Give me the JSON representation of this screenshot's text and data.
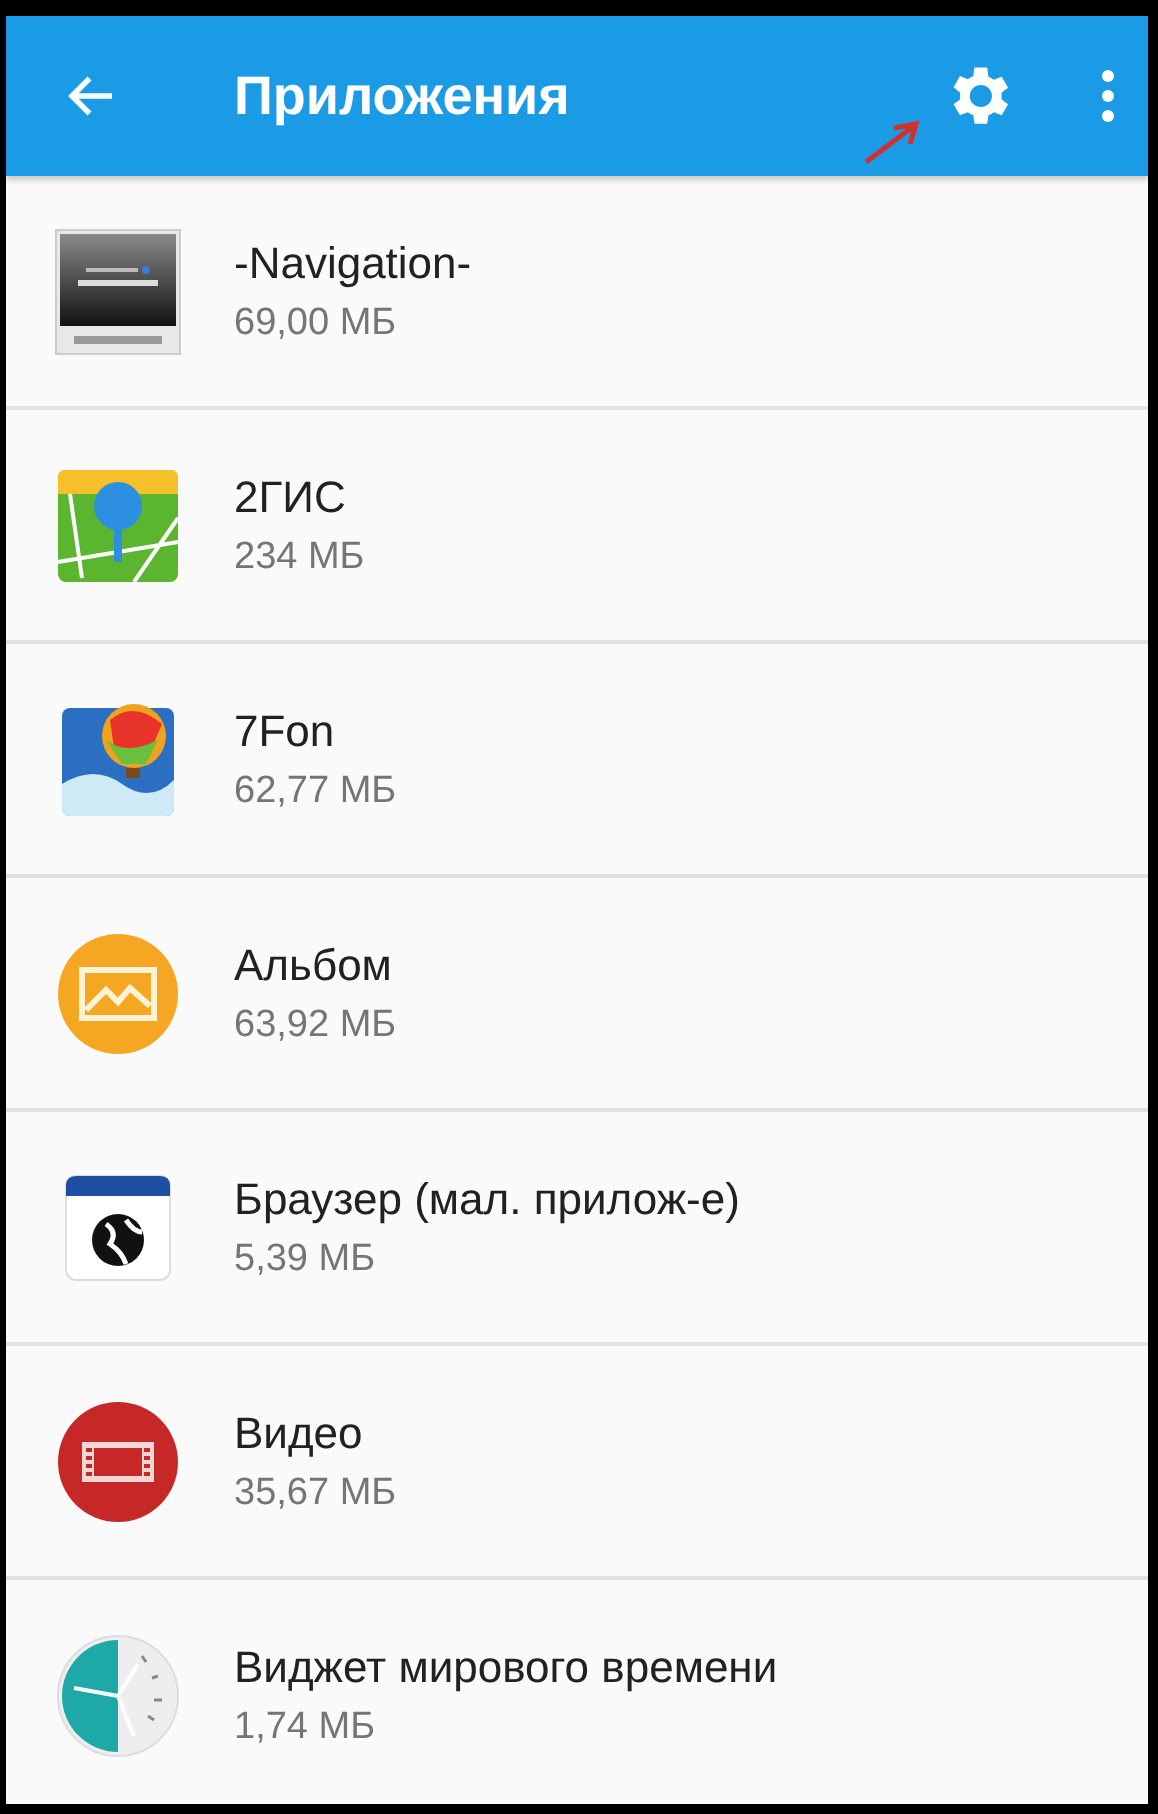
{
  "app_bar": {
    "title": "Приложения"
  },
  "apps": [
    {
      "name": "-Navigation-",
      "size": "69,00 МБ",
      "kind": "navigation"
    },
    {
      "name": "2ГИС",
      "size": "234 МБ",
      "kind": "map"
    },
    {
      "name": "7Fon",
      "size": "62,77 МБ",
      "kind": "balloon"
    },
    {
      "name": "Альбом",
      "size": "63,92 МБ",
      "kind": "album"
    },
    {
      "name": "Браузер (мал. прилож-е)",
      "size": "5,39 МБ",
      "kind": "browser"
    },
    {
      "name": "Видео",
      "size": "35,67 МБ",
      "kind": "video"
    },
    {
      "name": "Виджет мирового времени",
      "size": "1,74 МБ",
      "kind": "clock"
    }
  ]
}
